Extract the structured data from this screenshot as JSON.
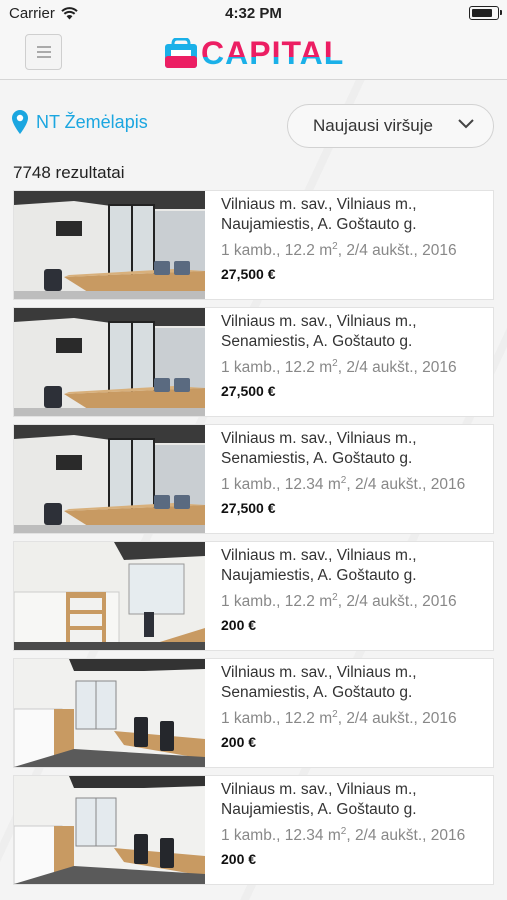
{
  "status_bar": {
    "carrier": "Carrier",
    "time": "4:32 PM",
    "battery_level": 0.85
  },
  "header": {
    "brand": "CAPITAL",
    "brand_colors": {
      "pink": "#ec1e63",
      "blue": "#1ab0e8"
    }
  },
  "toolbar": {
    "map_label": "NT Žemėlapis",
    "sort_value": "Naujausi viršuje",
    "results_count": "7748 rezultatai"
  },
  "listings": [
    {
      "addr1": "Vilniaus m. sav., Vilniaus m.,",
      "addr2": "Naujamiestis, A. Goštauto g.",
      "specs_pre": "1 kamb., 12.2 m",
      "sup": "2",
      "specs_post": ", 2/4 aukšt., 2016",
      "price": "27,500 €",
      "photo": "meeting-room-photo"
    },
    {
      "addr1": "Vilniaus m. sav., Vilniaus m.,",
      "addr2": "Senamiestis, A. Goštauto g.",
      "specs_pre": "1 kamb., 12.2 m",
      "sup": "2",
      "specs_post": ", 2/4 aukšt., 2016",
      "price": "27,500 €",
      "photo": "meeting-room-photo"
    },
    {
      "addr1": "Vilniaus m. sav., Vilniaus m.,",
      "addr2": "Senamiestis, A. Goštauto g.",
      "specs_pre": "1 kamb., 12.34 m",
      "sup": "2",
      "specs_post": ", 2/4 aukšt., 2016",
      "price": "27,500 €",
      "photo": "meeting-room-photo"
    },
    {
      "addr1": "Vilniaus m. sav., Vilniaus m.,",
      "addr2": "Naujamiestis, A. Goštauto g.",
      "specs_pre": "1 kamb., 12.2 m",
      "sup": "2",
      "specs_post": ", 2/4 aukšt., 2016",
      "price": "200 €",
      "photo": "office-shelves-photo"
    },
    {
      "addr1": "Vilniaus m. sav., Vilniaus m.,",
      "addr2": "Senamiestis, A. Goštauto g.",
      "specs_pre": "1 kamb., 12.2 m",
      "sup": "2",
      "specs_post": ", 2/4 aukšt., 2016",
      "price": "200 €",
      "photo": "office-desks-photo"
    },
    {
      "addr1": "Vilniaus m. sav., Vilniaus m.,",
      "addr2": "Naujamiestis, A. Goštauto g.",
      "specs_pre": "1 kamb., 12.34 m",
      "sup": "2",
      "specs_post": ", 2/4 aukšt., 2016",
      "price": "200 €",
      "photo": "office-desks-photo"
    }
  ]
}
